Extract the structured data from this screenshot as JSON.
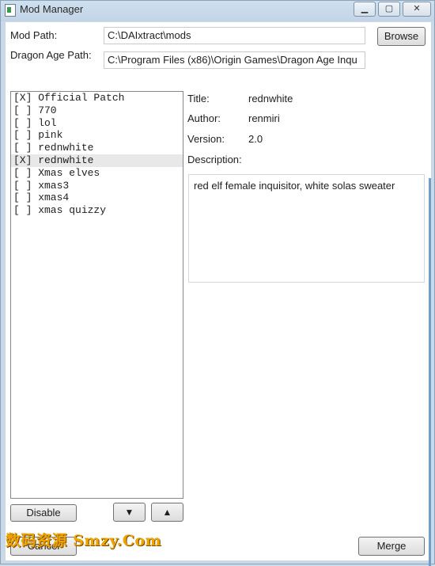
{
  "window": {
    "title": "Mod Manager",
    "minimize_glyph": "▁",
    "maximize_glyph": "▢",
    "close_glyph": "✕"
  },
  "paths": {
    "mod_path_label": "Mod Path:",
    "mod_path_value": "C:\\DAIxtract\\mods",
    "browse_label": "Browse",
    "dragon_age_path_label": "Dragon Age Path:",
    "dragon_age_path_value": "C:\\Program Files (x86)\\Origin Games\\Dragon Age Inqu"
  },
  "mods": [
    {
      "label": "[X] Official Patch",
      "selected": false
    },
    {
      "label": "[ ] 770",
      "selected": false
    },
    {
      "label": "[ ] lol",
      "selected": false
    },
    {
      "label": "[ ] pink",
      "selected": false
    },
    {
      "label": "[ ] rednwhite",
      "selected": false
    },
    {
      "label": "[X] rednwhite",
      "selected": true
    },
    {
      "label": "[ ] Xmas elves",
      "selected": false
    },
    {
      "label": "[ ] xmas3",
      "selected": false
    },
    {
      "label": "[ ] xmas4",
      "selected": false
    },
    {
      "label": "[ ] xmas quizzy",
      "selected": false
    }
  ],
  "details": {
    "title_label": "Title:",
    "title_value": "rednwhite",
    "author_label": "Author:",
    "author_value": "renmiri",
    "version_label": "Version:",
    "version_value": "2.0",
    "description_label": "Description:",
    "description_value": "red elf female inquisitor, white solas sweater"
  },
  "actions": {
    "disable_label": "Disable",
    "move_down_glyph": "▼",
    "move_up_glyph": "▲",
    "cancel_label": "Cancel",
    "merge_label": "Merge"
  },
  "watermark": {
    "text": "数码资源 Smzy.Com"
  },
  "colors": {
    "frame": "#c9d9e8",
    "selected_row": "#e8e8e8",
    "watermark": "#f0a400"
  }
}
